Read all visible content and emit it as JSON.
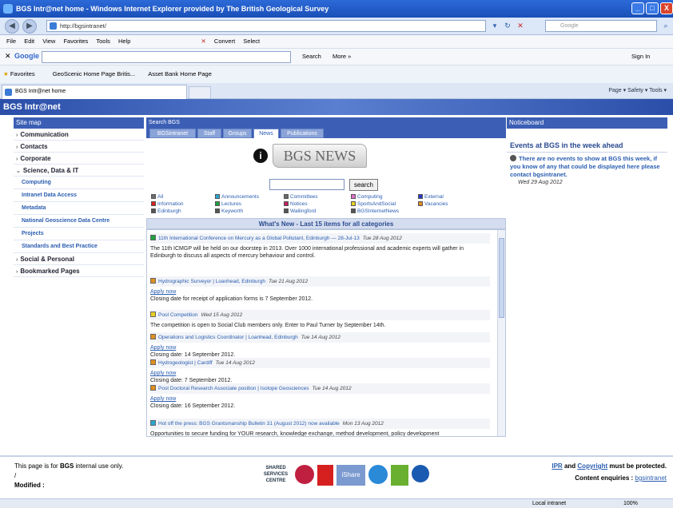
{
  "window": {
    "title": "BGS Intr@net home - Windows Internet Explorer provided by The British Geological Survey",
    "min": "_",
    "max": "□",
    "close": "X"
  },
  "address_bar": {
    "url": "http://bgsintranet/",
    "search_placeholder": "Google"
  },
  "menu": [
    "File",
    "Edit",
    "View",
    "Favorites",
    "Tools",
    "Help"
  ],
  "menu_extras": {
    "convert": "Convert",
    "select": "Select"
  },
  "google_bar": {
    "label": "Google",
    "search": "Search",
    "more": "More »",
    "signin": "Sign In"
  },
  "favorites": {
    "label": "Favorites",
    "items": [
      "GeoScenic Home Page Britis...",
      "Asset Bank Home Page"
    ]
  },
  "tab": {
    "label": "BGS Intr@net home"
  },
  "command_bar": "Page ▾  Safety ▾  Tools ▾",
  "banner": "BGS Intr@net",
  "sitemap": {
    "heading": "Site map",
    "items": [
      {
        "label": "Communication",
        "arrow": "›"
      },
      {
        "label": "Contacts",
        "arrow": "›"
      },
      {
        "label": "Corporate",
        "arrow": "›"
      },
      {
        "label": "Science, Data & IT",
        "arrow": "⌄"
      }
    ],
    "subitems": [
      "Computing",
      "Intranet Data Access",
      "Metadata",
      "National Geoscience Data Centre",
      "Projects",
      "Standards and Best Practice"
    ],
    "items_after": [
      {
        "label": "Social & Personal",
        "arrow": "›"
      },
      {
        "label": "Bookmarked Pages",
        "arrow": "›"
      }
    ]
  },
  "search": {
    "heading": "Search BGS",
    "tabs": [
      "BGSintranet",
      "Staff",
      "Groups",
      "News",
      "Publications"
    ],
    "active_tab": "News",
    "logo_i": "i",
    "logo_text": "BGS NEWS",
    "button": "search"
  },
  "categories": [
    {
      "label": "All",
      "color": "#6e6e6e"
    },
    {
      "label": "Announcements",
      "color": "#2aa7d4"
    },
    {
      "label": "Committees",
      "color": "#6a6a6a"
    },
    {
      "label": "Computing",
      "color": "#e070c8"
    },
    {
      "label": "External",
      "color": "#2a38c8"
    },
    {
      "label": "Information",
      "color": "#d82020"
    },
    {
      "label": "Lectures",
      "color": "#20a040"
    },
    {
      "label": "Notices",
      "color": "#c02060"
    },
    {
      "label": "SportsAndSocial",
      "color": "#e8d020"
    },
    {
      "label": "Vacancies",
      "color": "#e09020"
    },
    {
      "label": "Edinburgh",
      "color": "#555555"
    },
    {
      "label": "Keyworth",
      "color": "#555555"
    },
    {
      "label": "Wallingford",
      "color": "#555555"
    },
    {
      "label": "BGSInternetNews",
      "color": "#555555"
    }
  ],
  "whats_new": {
    "heading": "What's New - Last 15 items for all categories",
    "items": [
      {
        "title": "11th International Conference on Mercury as a Global Pollutant, Edinburgh — 28-Jul-13",
        "date": "Tue 28 Aug 2012",
        "icon_color": "#20a040",
        "link": "",
        "body": "The 11th ICMGP will be held on our doorstep in 2013. Over 1000 international professional and academic experts will gather in Edinburgh to discuss all aspects of mercury behaviour and control."
      },
      {
        "title": "Hydrographic Surveyor | Loanhead, Edinburgh",
        "date": "Tue 21 Aug 2012",
        "icon_color": "#e09020",
        "link": "Apply now",
        "body": "Closing date for receipt of application forms is 7 September 2012."
      },
      {
        "title": "Pool Competition",
        "date": "Wed 15 Aug 2012",
        "icon_color": "#e8d020",
        "link": "",
        "body": "The competition is open to Social Club members only. Enter to Paul Turner by September 14th."
      },
      {
        "title": "Operations and Logistics Coordinator | Loanhead, Edinburgh",
        "date": "Tue 14 Aug 2012",
        "icon_color": "#e09020",
        "link": "Apply now",
        "body": "Closing date: 14 September 2012."
      },
      {
        "title": "Hydrogeologist | Cardiff",
        "date": "Tue 14 Aug 2012",
        "icon_color": "#e09020",
        "link": "Apply now",
        "body": "Closing date: 7 September 2012."
      },
      {
        "title": "Post Doctoral Research Associate position | Isotope Geosciences",
        "date": "Tue 14 Aug 2012",
        "icon_color": "#e09020",
        "link": "Apply now",
        "body": "Closing date: 16 September 2012."
      },
      {
        "title": "Hot off the press: BGS Grantsmanship Bulletin 31 (August 2012) now available",
        "date": "Mon 13 Aug 2012",
        "icon_color": "#2aa7d4",
        "link": "",
        "body": "Opportunities to secure funding for YOUR research, knowledge exchange, method development, policy development"
      }
    ]
  },
  "noticeboard": {
    "heading": "Noticeboard",
    "title": "Events at BGS in the week ahead",
    "message": "There are no events to show at BGS this week, if you know of any that could be displayed here please contact bgsintranet.",
    "date": "Wed 29 Aug 2012"
  },
  "footer": {
    "internal_prefix": "This page is for",
    "internal_bold": "BGS",
    "internal_suffix": "internal use only.",
    "slash": "/",
    "modified": "Modified :",
    "ipr": "IPR",
    "and": "and",
    "copyright": "Copyright",
    "protected": "must be protected.",
    "enquiries": "Content enquiries :",
    "enquiries_link": "bgsintranet",
    "logo_ssc": "SHARED SERVICES CENTRE",
    "logo_ishare": "iShare"
  },
  "status": {
    "zone": "Local intranet",
    "zoom": "100%"
  }
}
